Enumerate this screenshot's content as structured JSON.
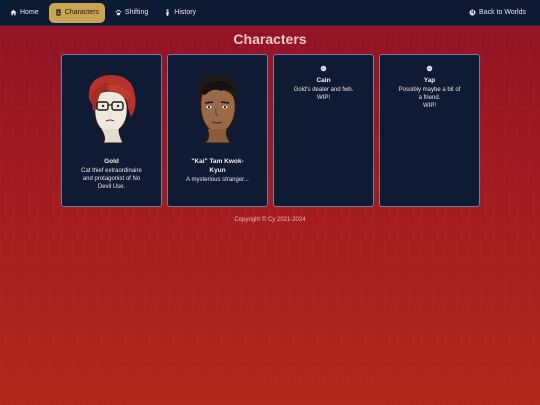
{
  "nav": {
    "items": [
      {
        "label": "Home",
        "icon": "home-icon",
        "active": false
      },
      {
        "label": "Characters",
        "icon": "id-card-icon",
        "active": true
      },
      {
        "label": "Shifting",
        "icon": "paw-icon",
        "active": false
      },
      {
        "label": "History",
        "icon": "person-icon",
        "active": false
      }
    ],
    "back_label": "Back to Worlds",
    "back_icon": "globe-icon",
    "active_color": "#c9a552"
  },
  "page": {
    "title": "Characters"
  },
  "cards": [
    {
      "name": "Gold",
      "desc_lines": [
        "Cat thief extraordinaire",
        "and protagonist of No",
        "Devil Use."
      ],
      "image": "portrait-gold"
    },
    {
      "name_lines": [
        "\"Kai\" Tam Kwok-",
        "Kyun"
      ],
      "desc_lines": [
        "A mysterious stranger..."
      ],
      "image": "portrait-kai"
    },
    {
      "name": "Cain",
      "desc_lines": [
        "Gold's dealer and fwb.",
        "WIP!"
      ],
      "image": "placeholder-icon"
    },
    {
      "name": "Yap",
      "desc_lines": [
        "Possibly maybe a bit of",
        "a friend.",
        "WIP!"
      ],
      "image": "placeholder-icon"
    }
  ],
  "footer": {
    "copyright": "Copyright © Cy 2021-2024"
  }
}
